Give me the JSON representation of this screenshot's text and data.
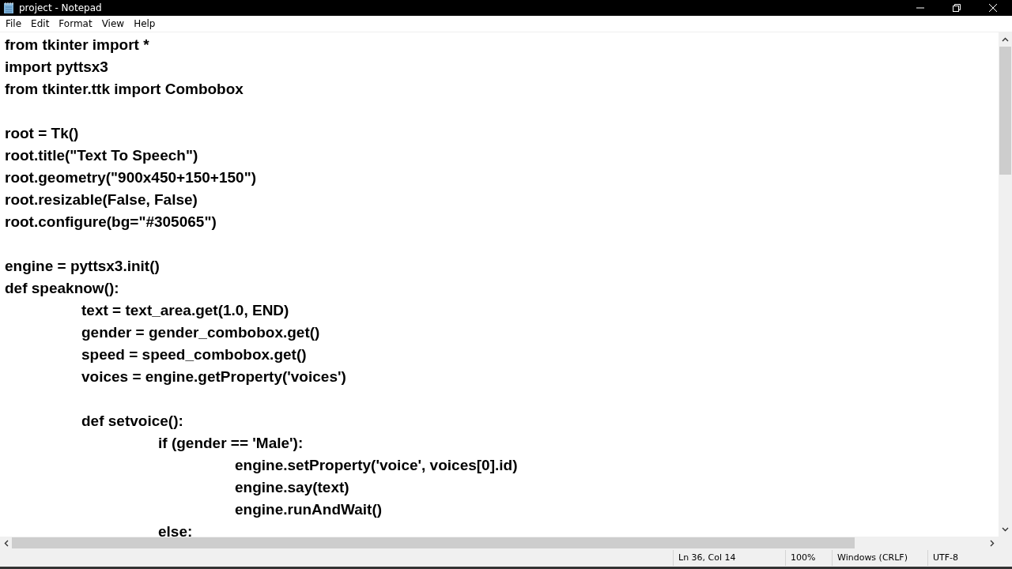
{
  "window": {
    "title": "project - Notepad"
  },
  "menu": [
    "File",
    "Edit",
    "Format",
    "View",
    "Help"
  ],
  "editor": {
    "blocks": [
      [
        "from tkinter import *",
        "import pyttsx3",
        "from tkinter.ttk import Combobox"
      ],
      [
        "root = Tk()",
        "root.title(\"Text To Speech\")",
        "root.geometry(\"900x450+150+150\")",
        "root.resizable(False, False)",
        "root.configure(bg=\"#305065\")"
      ],
      [
        "engine = pyttsx3.init()",
        "def speaknow():",
        "\ttext = text_area.get(1.0, END)",
        "\tgender = gender_combobox.get()",
        "\tspeed = speed_combobox.get()",
        "\tvoices = engine.getProperty('voices')"
      ],
      [
        "\tdef setvoice():",
        "\t\tif (gender == 'Male'):",
        "\t\t\tengine.setProperty('voice', voices[0].id)",
        "\t\t\tengine.say(text)",
        "\t\t\tengine.runAndWait()",
        "\t\telse:"
      ]
    ]
  },
  "status_bar": [
    "Ln 36, Col 14",
    "100%",
    "Windows (CRLF)",
    "UTF-8"
  ]
}
